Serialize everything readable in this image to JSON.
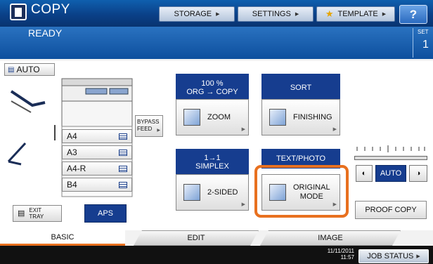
{
  "header": {
    "title": "COPY",
    "storage": "STORAGE",
    "settings": "SETTINGS",
    "template": "TEMPLATE",
    "help": "?"
  },
  "status": {
    "message": "READY",
    "set_label": "SET",
    "set_count": "1"
  },
  "paper": {
    "auto": "AUTO",
    "bypass_line1": "BYPASS",
    "bypass_line2": "FEED",
    "trays": [
      {
        "label": "A4"
      },
      {
        "label": "A3"
      },
      {
        "label": "A4-R"
      },
      {
        "label": "B4"
      }
    ],
    "exit_tray_line1": "EXIT",
    "exit_tray_line2": "TRAY",
    "aps": "APS"
  },
  "functions": {
    "zoom_head_line1": "100 %",
    "zoom_head_line2": "ORG → COPY",
    "zoom": "ZOOM",
    "sort_head": "SORT",
    "finishing": "FINISHING",
    "duplex_head_line1": "1→1",
    "duplex_head_line2": "SIMPLEX",
    "two_sided": "2-SIDED",
    "mode_head": "TEXT/PHOTO",
    "original_mode_line1": "ORIGINAL",
    "original_mode_line2": "MODE"
  },
  "density": {
    "auto": "AUTO"
  },
  "proof_copy": "PROOF COPY",
  "tabs": {
    "basic": "BASIC",
    "edit": "EDIT",
    "image": "IMAGE"
  },
  "footer": {
    "date": "11/11/2011",
    "time": "11:57",
    "job_status": "JOB STATUS"
  },
  "colors": {
    "accent_blue": "#163d8f",
    "highlight_orange": "#e8701f"
  }
}
